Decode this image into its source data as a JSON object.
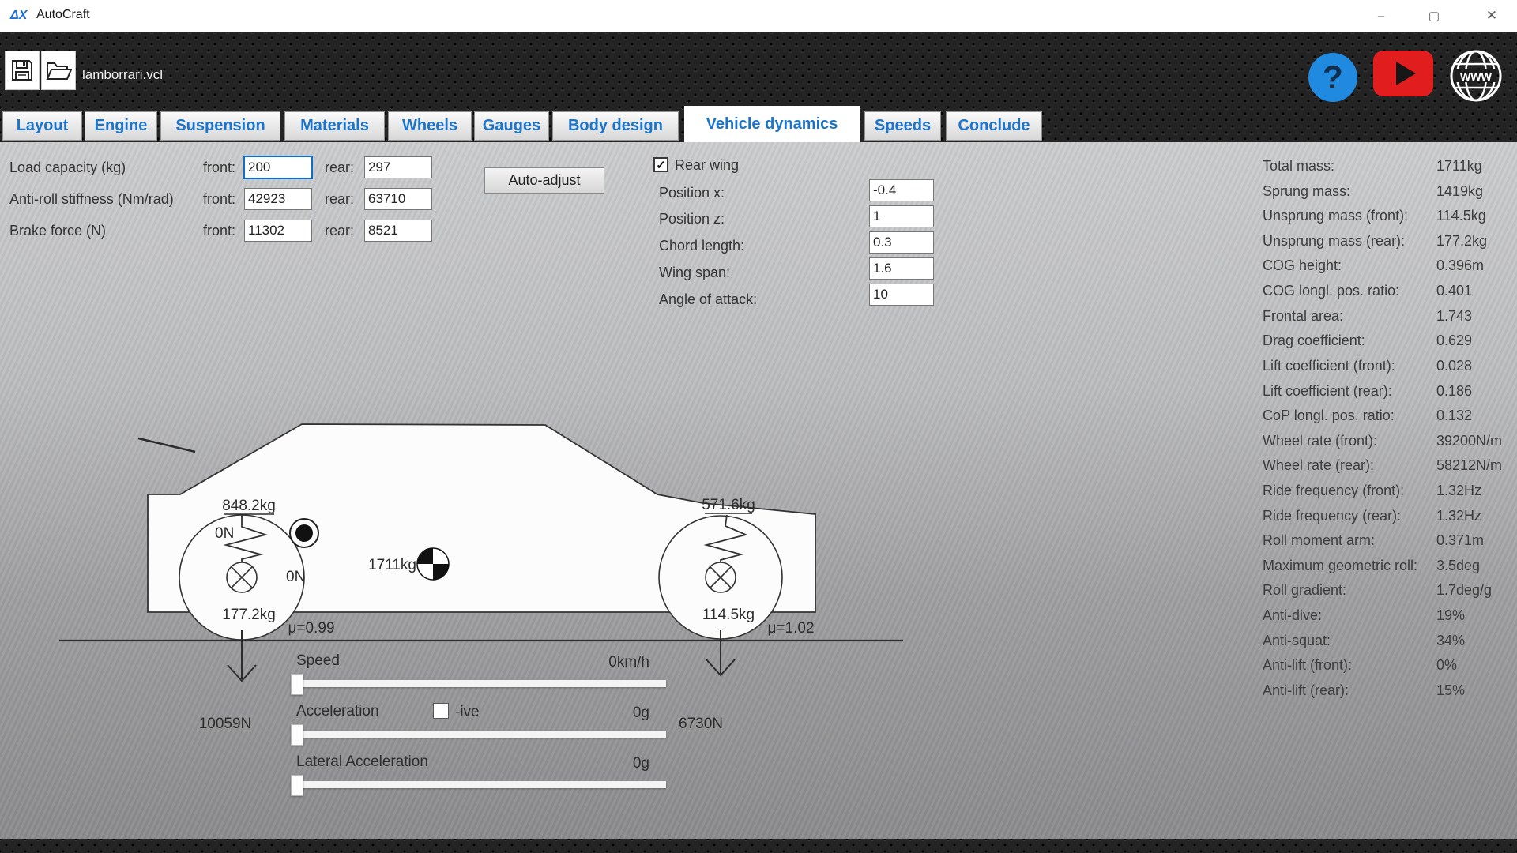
{
  "window": {
    "logo_glyph": "ΔX",
    "title": "AutoCraft",
    "minimize_glyph": "–",
    "maximize_glyph": "▢",
    "close_glyph": "✕"
  },
  "toolbar": {
    "filename": "lamborrari.vcl",
    "help_glyph": "?",
    "web_glyph": "www"
  },
  "tabs": [
    {
      "label": "Layout"
    },
    {
      "label": "Engine"
    },
    {
      "label": "Suspension"
    },
    {
      "label": "Materials"
    },
    {
      "label": "Wheels"
    },
    {
      "label": "Gauges"
    },
    {
      "label": "Body design"
    },
    {
      "label": "Vehicle dynamics",
      "active": true
    },
    {
      "label": "Speeds"
    },
    {
      "label": "Conclude"
    }
  ],
  "form": {
    "front_label": "front:",
    "rear_label": "rear:",
    "rows": [
      {
        "label": "Load capacity (kg)",
        "front": "200",
        "rear": "297"
      },
      {
        "label": "Anti-roll stiffness (Nm/rad)",
        "front": "42923",
        "rear": "63710"
      },
      {
        "label": "Brake force (N)",
        "front": "11302",
        "rear": "8521"
      }
    ],
    "auto_adjust_label": "Auto-adjust"
  },
  "rear_wing": {
    "label": "Rear wing",
    "check_glyph": "✓",
    "fields": [
      {
        "label": "Position x:",
        "value": "-0.4"
      },
      {
        "label": "Position z:",
        "value": "1"
      },
      {
        "label": "Chord length:",
        "value": "0.3"
      },
      {
        "label": "Wing span:",
        "value": "1.6"
      },
      {
        "label": "Angle of attack:",
        "value": "10"
      }
    ]
  },
  "stats": [
    {
      "label": "Total mass:",
      "value": "1711kg"
    },
    {
      "label": "Sprung mass:",
      "value": "1419kg"
    },
    {
      "label": "Unsprung mass (front):",
      "value": "114.5kg"
    },
    {
      "label": "Unsprung mass (rear):",
      "value": "177.2kg"
    },
    {
      "label": "COG height:",
      "value": "0.396m"
    },
    {
      "label": "COG longl. pos. ratio:",
      "value": "0.401"
    },
    {
      "label": "Frontal area:",
      "value": "1.743"
    },
    {
      "label": "Drag coefficient:",
      "value": "0.629"
    },
    {
      "label": "Lift coefficient (front):",
      "value": "0.028"
    },
    {
      "label": "Lift coefficient (rear):",
      "value": "0.186"
    },
    {
      "label": "CoP longl. pos. ratio:",
      "value": "0.132"
    },
    {
      "label": "Wheel rate (front):",
      "value": "39200N/m"
    },
    {
      "label": "Wheel rate (rear):",
      "value": "58212N/m"
    },
    {
      "label": "Ride frequency (front):",
      "value": "1.32Hz"
    },
    {
      "label": "Ride frequency (rear):",
      "value": "1.32Hz"
    },
    {
      "label": "Roll moment arm:",
      "value": "0.371m"
    },
    {
      "label": "Maximum geometric roll:",
      "value": "3.5deg"
    },
    {
      "label": "Roll gradient:",
      "value": "1.7deg/g"
    },
    {
      "label": "Anti-dive:",
      "value": "19%"
    },
    {
      "label": "Anti-squat:",
      "value": "34%"
    },
    {
      "label": "Anti-lift (front):",
      "value": "0%"
    },
    {
      "label": "Anti-lift (rear):",
      "value": "15%"
    }
  ],
  "diagram": {
    "rear_sprung_mass": "848.2kg",
    "front_sprung_mass": "571.6kg",
    "rear_unsprung_mass": "177.2kg",
    "front_unsprung_mass": "114.5kg",
    "total_mass": "1711kg",
    "damper_force_upper": "0N",
    "damper_force_lower": "0N",
    "mu_rear": "μ=0.99",
    "mu_front": "μ=1.02",
    "rear_tyre_load": "10059N",
    "front_tyre_load": "6730N"
  },
  "sliders": {
    "speed": {
      "label": "Speed",
      "value": "0km/h"
    },
    "acceleration": {
      "label": "Acceleration",
      "value": "0g",
      "negative_label": "-ive"
    },
    "lateral": {
      "label": "Lateral Acceleration",
      "value": "0g"
    }
  }
}
